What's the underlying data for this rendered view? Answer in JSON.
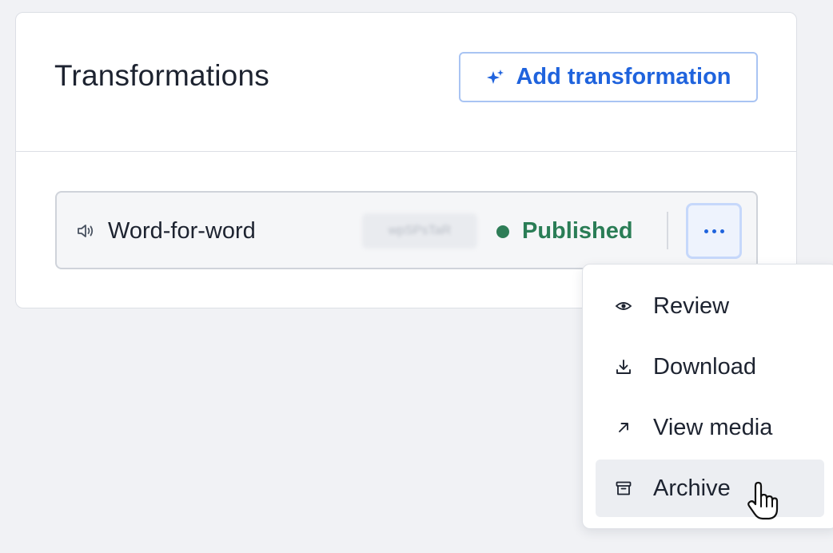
{
  "card": {
    "title": "Transformations",
    "add_button_label": "Add transformation",
    "add_button_icon": "sparkle-icon"
  },
  "transformation_row": {
    "icon": "speaker-icon",
    "name": "Word-for-word",
    "id_chip": "wpSPsTaR",
    "status": "Published",
    "status_color": "#2e7d57",
    "more_icon": "ellipsis-icon"
  },
  "actions_menu": {
    "items": [
      {
        "label": "Review",
        "icon": "eye-icon"
      },
      {
        "label": "Download",
        "icon": "download-icon"
      },
      {
        "label": "View media",
        "icon": "arrow-up-right-icon"
      },
      {
        "label": "Archive",
        "icon": "archive-icon",
        "hovered": true
      }
    ]
  },
  "colors": {
    "accent": "#1f63dd",
    "published": "#2a7d56",
    "background": "#f1f2f5"
  }
}
